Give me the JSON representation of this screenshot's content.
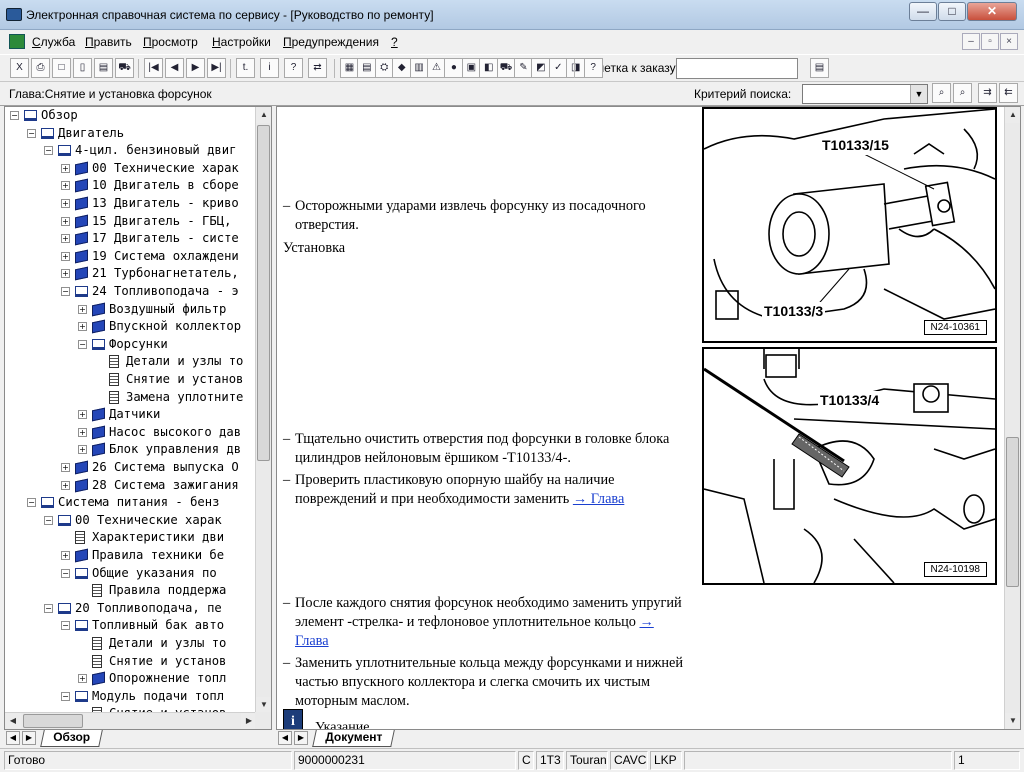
{
  "window": {
    "title": "Электронная справочная система по сервису - [Руководство по ремонту]",
    "minimize_label": "—",
    "maximize_label": "□",
    "close_label": "✕"
  },
  "menu": [
    {
      "underline": "С",
      "rest": "лужба"
    },
    {
      "underline": "П",
      "rest": "равить"
    },
    {
      "underline": "П",
      "rest": "росмотр"
    },
    {
      "underline": "Н",
      "rest": "астройки"
    },
    {
      "underline": "П",
      "rest": "редупреждения"
    },
    {
      "underline": "?",
      "rest": ""
    }
  ],
  "mdi_controls": [
    "–",
    "▫",
    "×"
  ],
  "toolbar": {
    "buttons_group1": [
      "X",
      "⎙",
      "□",
      "▯",
      "▤",
      "⛟"
    ],
    "buttons_nav": [
      "|◀",
      "◀",
      "▶",
      "▶|"
    ],
    "buttons_group3": [
      "t.",
      "i",
      "?",
      "⇄"
    ],
    "buttons_group4": [
      "▦",
      "▤",
      "⛭",
      "◆",
      "▥",
      "⚠",
      "●",
      "▣",
      "◧",
      "⛟",
      "✎",
      "◩",
      "✓",
      "◨",
      "?"
    ],
    "note_label": "Заметка к заказу:",
    "note_value": ""
  },
  "chapter": {
    "label": "Глава:Снятие и установка форсунок",
    "criteria_label": "Критерий  поиска:",
    "criteria_value": ""
  },
  "tree": [
    {
      "level": 0,
      "exp": "-",
      "icon": "open",
      "text": "Обзор"
    },
    {
      "level": 1,
      "exp": "-",
      "icon": "open",
      "text": "Двигатель"
    },
    {
      "level": 2,
      "exp": "-",
      "icon": "open",
      "text": "4-цил. бензиновый двиг"
    },
    {
      "level": 3,
      "exp": "+",
      "icon": "closed",
      "text": "00 Технические харак"
    },
    {
      "level": 3,
      "exp": "+",
      "icon": "closed",
      "text": "10 Двигатель в сборе"
    },
    {
      "level": 3,
      "exp": "+",
      "icon": "closed",
      "text": "13 Двигатель - криво"
    },
    {
      "level": 3,
      "exp": "+",
      "icon": "closed",
      "text": "15 Двигатель - ГБЦ,"
    },
    {
      "level": 3,
      "exp": "+",
      "icon": "closed",
      "text": "17 Двигатель - систе"
    },
    {
      "level": 3,
      "exp": "+",
      "icon": "closed",
      "text": "19 Система охлаждени"
    },
    {
      "level": 3,
      "exp": "+",
      "icon": "closed",
      "text": "21 Турбонагнетатель,"
    },
    {
      "level": 3,
      "exp": "-",
      "icon": "open",
      "text": "24 Топливоподача - э"
    },
    {
      "level": 4,
      "exp": "+",
      "icon": "closed",
      "text": "Воздушный фильтр"
    },
    {
      "level": 4,
      "exp": "+",
      "icon": "closed",
      "text": "Впускной коллектор"
    },
    {
      "level": 4,
      "exp": "-",
      "icon": "open",
      "text": "Форсунки"
    },
    {
      "level": 5,
      "exp": "",
      "icon": "doc",
      "text": "Детали и узлы то"
    },
    {
      "level": 5,
      "exp": "",
      "icon": "doc",
      "text": "Снятие и установ"
    },
    {
      "level": 5,
      "exp": "",
      "icon": "doc",
      "text": "Замена уплотните"
    },
    {
      "level": 4,
      "exp": "+",
      "icon": "closed",
      "text": "Датчики"
    },
    {
      "level": 4,
      "exp": "+",
      "icon": "closed",
      "text": "Насос высокого дав"
    },
    {
      "level": 4,
      "exp": "+",
      "icon": "closed",
      "text": "Блок управления дв"
    },
    {
      "level": 3,
      "exp": "+",
      "icon": "closed",
      "text": "26 Система выпуска О"
    },
    {
      "level": 3,
      "exp": "+",
      "icon": "closed",
      "text": "28 Система зажигания"
    },
    {
      "level": 1,
      "exp": "-",
      "icon": "open",
      "text": "Система питания - бенз"
    },
    {
      "level": 2,
      "exp": "-",
      "icon": "open",
      "text": "00 Технические харак"
    },
    {
      "level": 3,
      "exp": "",
      "icon": "doc",
      "text": "Характеристики дви"
    },
    {
      "level": 3,
      "exp": "+",
      "icon": "closed",
      "text": "Правила техники бе"
    },
    {
      "level": 3,
      "exp": "-",
      "icon": "open",
      "text": "Общие указания по"
    },
    {
      "level": 4,
      "exp": "",
      "icon": "doc",
      "text": "Правила поддержа"
    },
    {
      "level": 2,
      "exp": "-",
      "icon": "open",
      "text": "20 Топливоподача, пе"
    },
    {
      "level": 3,
      "exp": "-",
      "icon": "open",
      "text": "Топливный бак авто"
    },
    {
      "level": 4,
      "exp": "",
      "icon": "doc",
      "text": "Детали и узлы то"
    },
    {
      "level": 4,
      "exp": "",
      "icon": "doc",
      "text": "Снятие и установ"
    },
    {
      "level": 4,
      "exp": "+",
      "icon": "closed",
      "text": "Опорожнение топл"
    },
    {
      "level": 3,
      "exp": "-",
      "icon": "open",
      "text": "Модуль подачи топл"
    },
    {
      "level": 4,
      "exp": "",
      "icon": "doc",
      "text": "Снятие и установ"
    }
  ],
  "doc": {
    "p1": "Осторожными ударами извлечь форсунку из посадочного отверстия.",
    "heading_install": "Установка",
    "p2": "Тщательно очистить отверстия под форсунки в головке блока цилиндров нейлоновым ёршиком -T10133/4-.",
    "p3": "Проверить пластиковую опорную шайбу на наличие повреждений и при необходимости заменить",
    "p3_link": "→ Глава",
    "p4": "После каждого снятия форсунок необходимо заменить упругий элемент -стрелка- и тефлоновое уплотнительное кольцо",
    "p4_link": "→ Глава",
    "p5": "Заменить уплотнительные кольца между форсунками и нижней частью впускного коллектора и слегка смочить их чистым моторным маслом.",
    "hint": "Указание",
    "dash": "–"
  },
  "figure1": {
    "label_a": "T10133/15",
    "label_b": "T10133/3",
    "caption": "N24-10361"
  },
  "figure2": {
    "label_a": "T10133/4",
    "caption": "N24-10198"
  },
  "tabs": {
    "left": "Обзор",
    "right": "Документ"
  },
  "status": {
    "ready": "Готово",
    "order": "9000000231",
    "c": "C",
    "code": "1T3",
    "model": "Touran",
    "engine": "CAVC",
    "gear": "LKP",
    "empty": "",
    "page": "1"
  }
}
